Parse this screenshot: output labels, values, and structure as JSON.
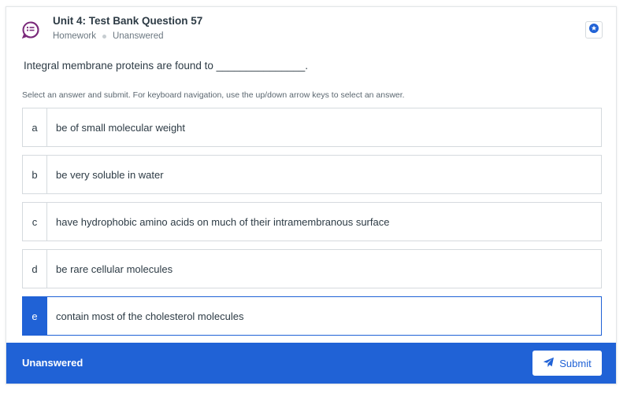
{
  "header": {
    "title": "Unit 4: Test Bank Question 57",
    "type": "Homework",
    "status": "Unanswered",
    "question_icon": "question-list-icon",
    "bookmark_icon": "star-icon",
    "accent": "#7a2a7a"
  },
  "question": {
    "prompt": "Integral membrane proteins are found to _______________.",
    "instructions": "Select an answer and submit. For keyboard navigation, use the up/down arrow keys to select an answer."
  },
  "options": [
    {
      "letter": "a",
      "text": "be of small molecular weight"
    },
    {
      "letter": "b",
      "text": "be very soluble in water"
    },
    {
      "letter": "c",
      "text": "have hydrophobic amino acids on much of their intramembranous surface"
    },
    {
      "letter": "d",
      "text": "be rare cellular molecules"
    },
    {
      "letter": "e",
      "text": "contain most of the cholesterol molecules"
    }
  ],
  "selected_option": "e",
  "footer": {
    "status": "Unanswered",
    "submit_label": "Submit",
    "submit_icon": "paper-plane-icon",
    "color": "#2062d6"
  }
}
